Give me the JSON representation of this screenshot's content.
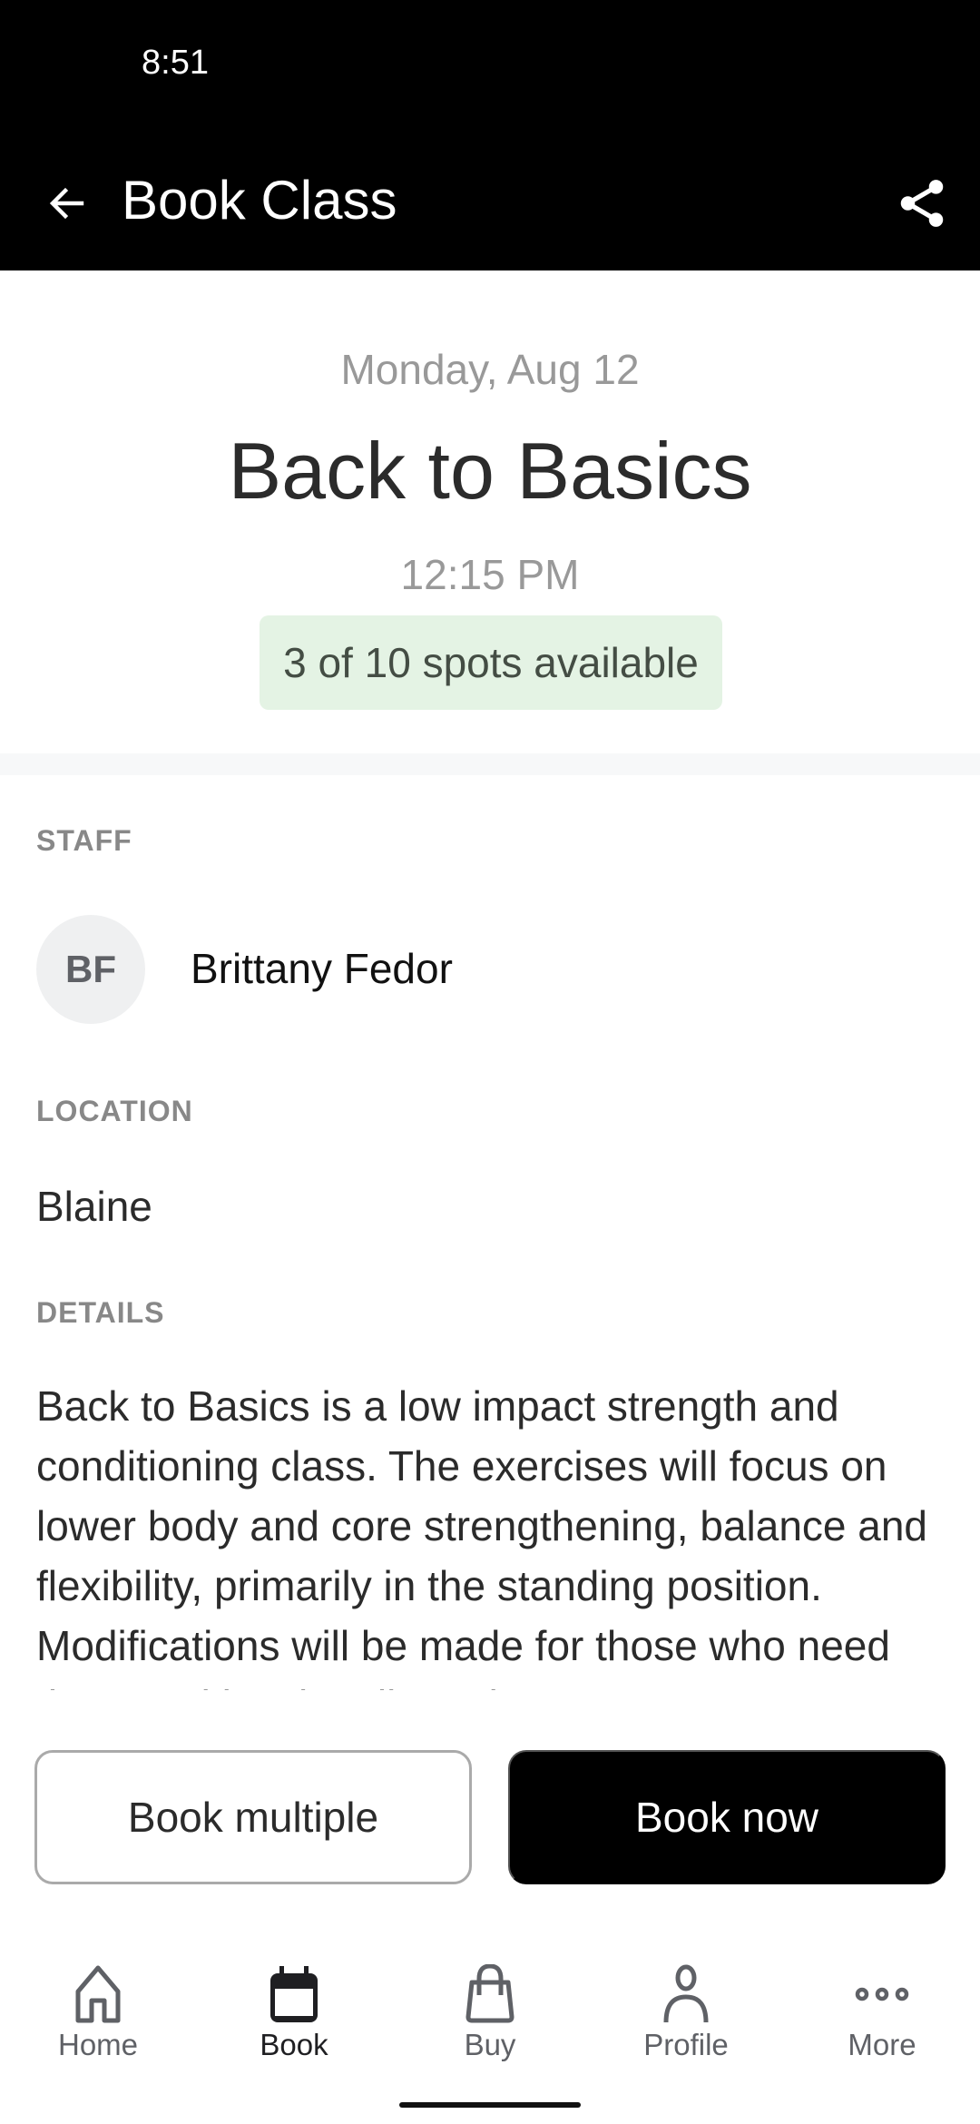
{
  "status_bar": {
    "time": "8:51"
  },
  "app_bar": {
    "title": "Book Class",
    "back_icon": "arrow-left-icon",
    "share_icon": "share-icon"
  },
  "class": {
    "date": "Monday, Aug 12",
    "title": "Back to Basics",
    "time": "12:15 PM",
    "spots_text": "3 of 10 spots available",
    "spots_available": 3,
    "spots_total": 10,
    "spots_badge_color": "#e4f3e4"
  },
  "staff": {
    "label": "STAFF",
    "initials": "BF",
    "name": "Brittany Fedor"
  },
  "location": {
    "label": "LOCATION",
    "value": "Blaine"
  },
  "details": {
    "label": "DETAILS",
    "text": "Back to Basics is a low impact strength and conditioning class. The exercises will focus on lower body and core strengthening, balance and flexibility, primarily in the standing position. Modifications will be made for those who need them and levels adjusted"
  },
  "actions": {
    "book_multiple_label": "Book multiple",
    "book_now_label": "Book now"
  },
  "bottom_nav": {
    "items": [
      {
        "label": "Home",
        "icon": "home-icon",
        "active": false
      },
      {
        "label": "Book",
        "icon": "calendar-icon",
        "active": true
      },
      {
        "label": "Buy",
        "icon": "shopping-bag-icon",
        "active": false
      },
      {
        "label": "Profile",
        "icon": "person-icon",
        "active": false
      },
      {
        "label": "More",
        "icon": "more-dots-icon",
        "active": false
      }
    ]
  }
}
